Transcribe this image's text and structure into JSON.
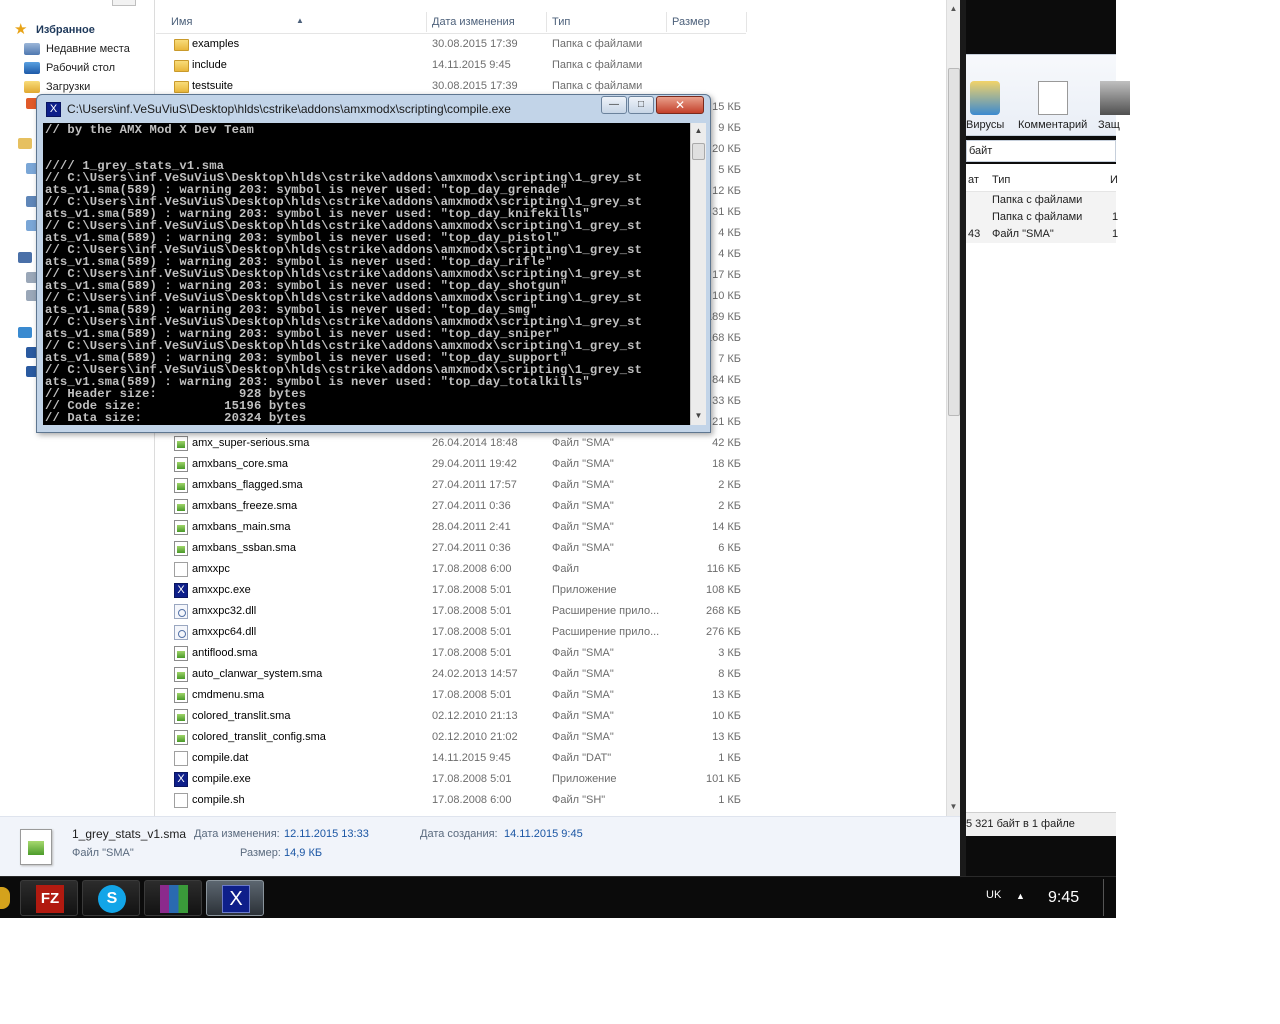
{
  "nav": {
    "favorites": "Избранное",
    "items": [
      "Недавние места",
      "Рабочий стол",
      "Загрузки"
    ]
  },
  "columns": {
    "name": "Имя",
    "date": "Дата изменения",
    "type": "Тип",
    "size": "Размер"
  },
  "files_top": [
    {
      "name": "examples",
      "date": "30.08.2015 17:39",
      "type": "Папка с файлами",
      "size": "",
      "icon": "folder-icon"
    },
    {
      "name": "include",
      "date": "14.11.2015 9:45",
      "type": "Папка с файлами",
      "size": "",
      "icon": "folder-icon"
    },
    {
      "name": "testsuite",
      "date": "30.08.2015 17:39",
      "type": "Папка с файлами",
      "size": "",
      "icon": "folder-icon"
    }
  ],
  "hidden_sizes": [
    "15 КБ",
    "9 КБ",
    "20 КБ",
    "5 КБ",
    "12 КБ",
    "31 КБ",
    "4 КБ",
    "4 КБ",
    "17 КБ",
    "10 КБ",
    "189 КБ",
    "168 КБ",
    "7 КБ",
    "84 КБ",
    "33 КБ",
    "21 КБ"
  ],
  "files": [
    {
      "name": "amx_super-serious.sma",
      "date": "26.04.2014 18:48",
      "type": "Файл \"SMA\"",
      "size": "42 КБ",
      "icon": "sma-file-icon"
    },
    {
      "name": "amxbans_core.sma",
      "date": "29.04.2011 19:42",
      "type": "Файл \"SMA\"",
      "size": "18 КБ",
      "icon": "sma-file-icon"
    },
    {
      "name": "amxbans_flagged.sma",
      "date": "27.04.2011 17:57",
      "type": "Файл \"SMA\"",
      "size": "2 КБ",
      "icon": "sma-file-icon"
    },
    {
      "name": "amxbans_freeze.sma",
      "date": "27.04.2011 0:36",
      "type": "Файл \"SMA\"",
      "size": "2 КБ",
      "icon": "sma-file-icon"
    },
    {
      "name": "amxbans_main.sma",
      "date": "28.04.2011 2:41",
      "type": "Файл \"SMA\"",
      "size": "14 КБ",
      "icon": "sma-file-icon"
    },
    {
      "name": "amxbans_ssban.sma",
      "date": "27.04.2011 0:36",
      "type": "Файл \"SMA\"",
      "size": "6 КБ",
      "icon": "sma-file-icon"
    },
    {
      "name": "amxxpc",
      "date": "17.08.2008 6:00",
      "type": "Файл",
      "size": "116 КБ",
      "icon": "file-icon"
    },
    {
      "name": "amxxpc.exe",
      "date": "17.08.2008 5:01",
      "type": "Приложение",
      "size": "108 КБ",
      "icon": "exe-icon"
    },
    {
      "name": "amxxpc32.dll",
      "date": "17.08.2008 5:01",
      "type": "Расширение прило...",
      "size": "268 КБ",
      "icon": "dll-icon"
    },
    {
      "name": "amxxpc64.dll",
      "date": "17.08.2008 5:01",
      "type": "Расширение прило...",
      "size": "276 КБ",
      "icon": "dll-icon"
    },
    {
      "name": "antiflood.sma",
      "date": "17.08.2008 5:01",
      "type": "Файл \"SMA\"",
      "size": "3 КБ",
      "icon": "sma-file-icon"
    },
    {
      "name": "auto_clanwar_system.sma",
      "date": "24.02.2013 14:57",
      "type": "Файл \"SMA\"",
      "size": "8 КБ",
      "icon": "sma-file-icon"
    },
    {
      "name": "cmdmenu.sma",
      "date": "17.08.2008 5:01",
      "type": "Файл \"SMA\"",
      "size": "13 КБ",
      "icon": "sma-file-icon"
    },
    {
      "name": "colored_translit.sma",
      "date": "02.12.2010 21:13",
      "type": "Файл \"SMA\"",
      "size": "10 КБ",
      "icon": "sma-file-icon"
    },
    {
      "name": "colored_translit_config.sma",
      "date": "02.12.2010 21:02",
      "type": "Файл \"SMA\"",
      "size": "13 КБ",
      "icon": "sma-file-icon"
    },
    {
      "name": "compile.dat",
      "date": "14.11.2015 9:45",
      "type": "Файл \"DAT\"",
      "size": "1 КБ",
      "icon": "file-icon"
    },
    {
      "name": "compile.exe",
      "date": "17.08.2008 5:01",
      "type": "Приложение",
      "size": "101 КБ",
      "icon": "exe-icon"
    },
    {
      "name": "compile.sh",
      "date": "17.08.2008 6:00",
      "type": "Файл \"SH\"",
      "size": "1 КБ",
      "icon": "file-icon"
    }
  ],
  "details": {
    "filename": "1_grey_stats_v1.sma",
    "filetype": "Файл \"SMA\"",
    "modified_label": "Дата изменения:",
    "modified_value": "12.11.2015 13:33",
    "created_label": "Дата создания:",
    "created_value": "14.11.2015 9:45",
    "size_label": "Размер:",
    "size_value": "14,9 КБ"
  },
  "console": {
    "title": "C:\\Users\\inf.VeSuViuS\\Desktop\\hlds\\cstrike\\addons\\amxmodx\\scripting\\compile.exe",
    "minimize": "—",
    "maximize": "□",
    "close": "✕",
    "output": "// by the AMX Mod X Dev Team\n\n\n//// 1_grey_stats_v1.sma\n// C:\\Users\\inf.VeSuViuS\\Desktop\\hlds\\cstrike\\addons\\amxmodx\\scripting\\1_grey_st\nats_v1.sma(589) : warning 203: symbol is never used: \"top_day_grenade\"\n// C:\\Users\\inf.VeSuViuS\\Desktop\\hlds\\cstrike\\addons\\amxmodx\\scripting\\1_grey_st\nats_v1.sma(589) : warning 203: symbol is never used: \"top_day_knifekills\"\n// C:\\Users\\inf.VeSuViuS\\Desktop\\hlds\\cstrike\\addons\\amxmodx\\scripting\\1_grey_st\nats_v1.sma(589) : warning 203: symbol is never used: \"top_day_pistol\"\n// C:\\Users\\inf.VeSuViuS\\Desktop\\hlds\\cstrike\\addons\\amxmodx\\scripting\\1_grey_st\nats_v1.sma(589) : warning 203: symbol is never used: \"top_day_rifle\"\n// C:\\Users\\inf.VeSuViuS\\Desktop\\hlds\\cstrike\\addons\\amxmodx\\scripting\\1_grey_st\nats_v1.sma(589) : warning 203: symbol is never used: \"top_day_shotgun\"\n// C:\\Users\\inf.VeSuViuS\\Desktop\\hlds\\cstrike\\addons\\amxmodx\\scripting\\1_grey_st\nats_v1.sma(589) : warning 203: symbol is never used: \"top_day_smg\"\n// C:\\Users\\inf.VeSuViuS\\Desktop\\hlds\\cstrike\\addons\\amxmodx\\scripting\\1_grey_st\nats_v1.sma(589) : warning 203: symbol is never used: \"top_day_sniper\"\n// C:\\Users\\inf.VeSuViuS\\Desktop\\hlds\\cstrike\\addons\\amxmodx\\scripting\\1_grey_st\nats_v1.sma(589) : warning 203: symbol is never used: \"top_day_support\"\n// C:\\Users\\inf.VeSuViuS\\Desktop\\hlds\\cstrike\\addons\\amxmodx\\scripting\\1_grey_st\nats_v1.sma(589) : warning 203: symbol is never used: \"top_day_totalkills\"\n// Header size:           928 bytes\n// Code size:           15196 bytes\n// Data size:           20324 bytes"
  },
  "right_window": {
    "btn_viruses": "Вирусы",
    "btn_comment": "Комментарий",
    "btn_protect": "Защ",
    "address": "байт",
    "col_a": "ат",
    "col_type": "Тип",
    "col_c": "И",
    "rows": [
      {
        "a": "",
        "type": "Папка с файлами",
        "c": ""
      },
      {
        "a": "",
        "type": "Папка с файлами",
        "c": "1"
      },
      {
        "a": "43",
        "type": "Файл \"SMA\"",
        "c": "1"
      }
    ],
    "status": "5 321 байт в 1 файле"
  },
  "taskbar": {
    "lang": "UK",
    "tray_arrow": "▲",
    "clock": "9:45",
    "apps": [
      {
        "name": "filezilla",
        "label": "FZ"
      },
      {
        "name": "skype",
        "label": "S"
      },
      {
        "name": "winrar",
        "label": ""
      },
      {
        "name": "compile",
        "label": "X"
      }
    ]
  },
  "colors": {
    "accent_link": "#1b56a4",
    "console_bg": "#000000",
    "console_text": "#c0c0c0"
  }
}
